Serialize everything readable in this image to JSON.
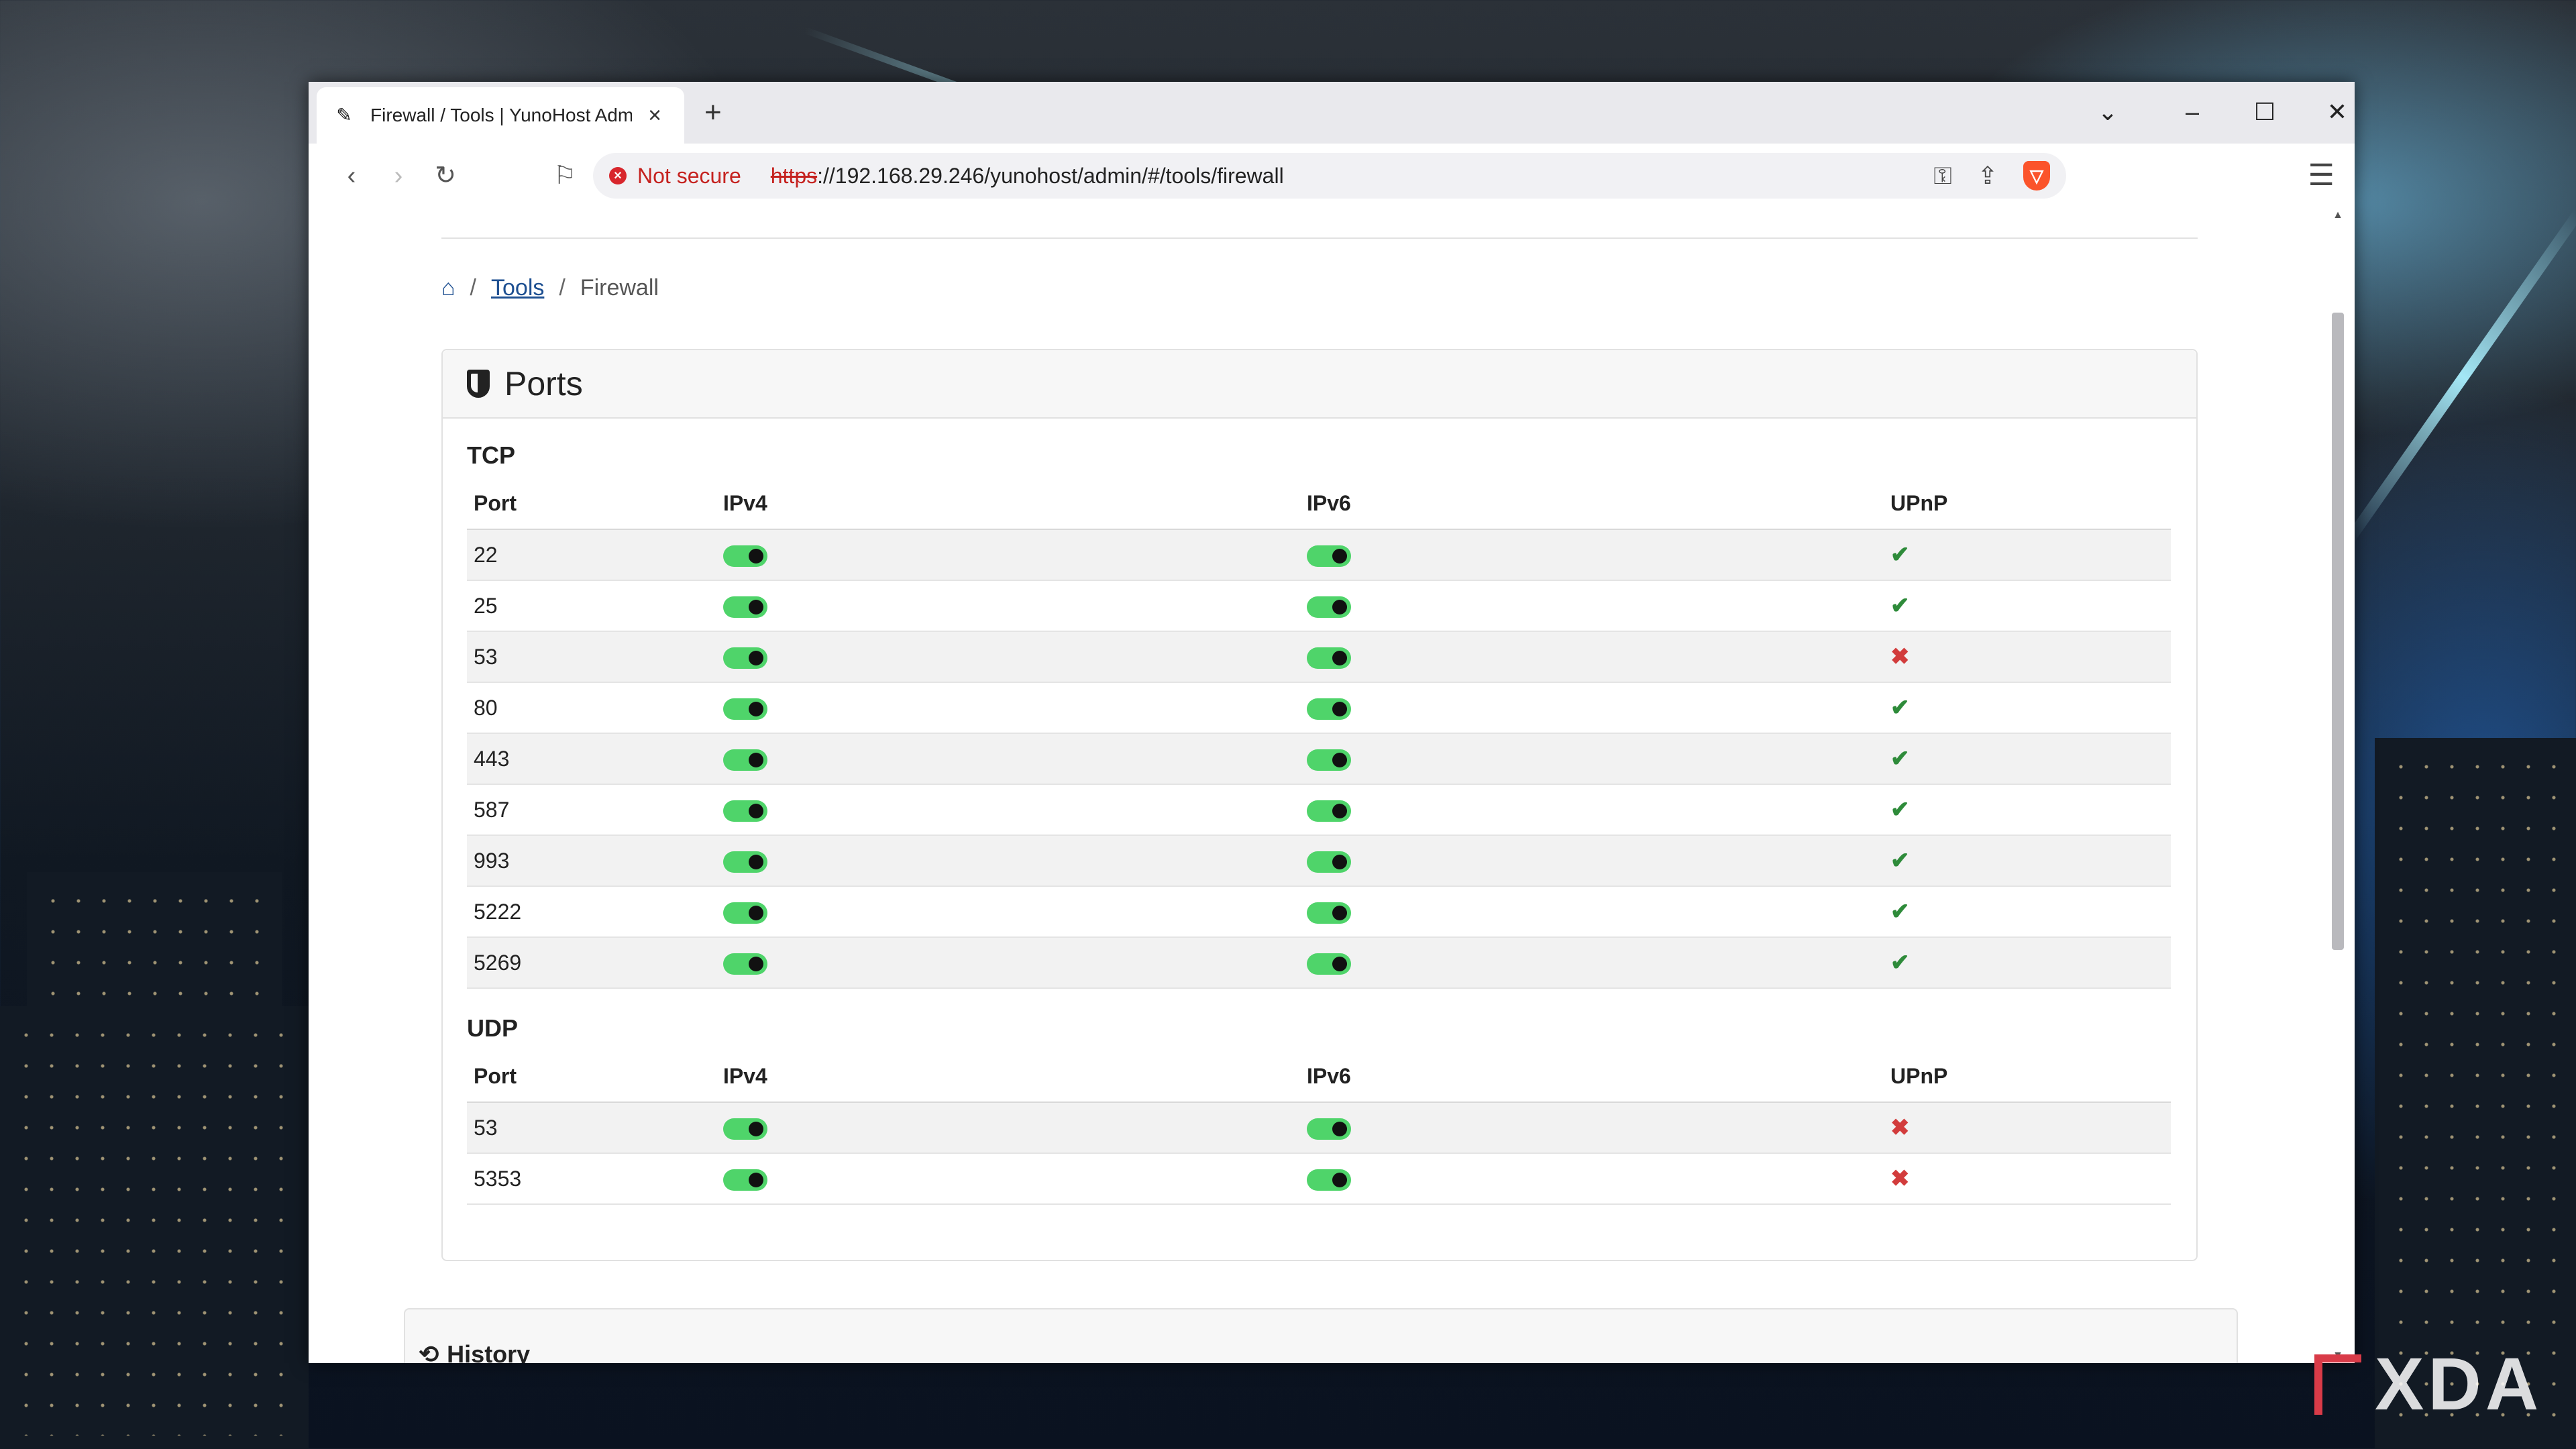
{
  "browser": {
    "tab_title": "Firewall / Tools | YunoHost Admin",
    "new_tab_icon": "+",
    "security_label": "Not secure",
    "url_scheme": "https",
    "url_rest": "://192.168.29.246/yunohost/admin/#/tools/firewall"
  },
  "breadcrumb": {
    "tools": "Tools",
    "current": "Firewall"
  },
  "ports_card": {
    "title": "Ports",
    "tcp_label": "TCP",
    "udp_label": "UDP",
    "headers": {
      "port": "Port",
      "ipv4": "IPv4",
      "ipv6": "IPv6",
      "upnp": "UPnP"
    },
    "tcp": [
      {
        "port": "22",
        "ipv4": true,
        "ipv6": true,
        "upnp": true
      },
      {
        "port": "25",
        "ipv4": true,
        "ipv6": true,
        "upnp": true
      },
      {
        "port": "53",
        "ipv4": true,
        "ipv6": true,
        "upnp": false
      },
      {
        "port": "80",
        "ipv4": true,
        "ipv6": true,
        "upnp": true
      },
      {
        "port": "443",
        "ipv4": true,
        "ipv6": true,
        "upnp": true
      },
      {
        "port": "587",
        "ipv4": true,
        "ipv6": true,
        "upnp": true
      },
      {
        "port": "993",
        "ipv4": true,
        "ipv6": true,
        "upnp": true
      },
      {
        "port": "5222",
        "ipv4": true,
        "ipv6": true,
        "upnp": true
      },
      {
        "port": "5269",
        "ipv4": true,
        "ipv6": true,
        "upnp": true
      }
    ],
    "udp": [
      {
        "port": "53",
        "ipv4": true,
        "ipv6": true,
        "upnp": false
      },
      {
        "port": "5353",
        "ipv4": true,
        "ipv6": true,
        "upnp": false
      }
    ]
  },
  "history": {
    "title": "History"
  },
  "watermark": "XDA",
  "colors": {
    "toggle_on": "#4fd46a",
    "upnp_yes": "#2e8b3a",
    "upnp_no": "#d23c3c",
    "link": "#1d4f91"
  }
}
